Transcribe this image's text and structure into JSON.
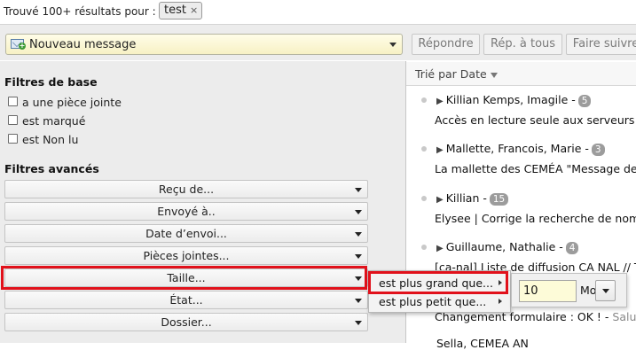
{
  "search": {
    "found_label": "Trouvé 100+ résultats pour :",
    "token": "test",
    "token_remove": "×"
  },
  "toolbar": {
    "compose_label": "Nouveau message",
    "reply": "Répondre",
    "reply_all": "Rép. à tous",
    "forward": "Faire suivre"
  },
  "filters": {
    "basic_title": "Filtres de base",
    "basic": [
      {
        "label": "a une pièce jointe",
        "checked": false
      },
      {
        "label": "est marqué",
        "checked": false
      },
      {
        "label": "est Non lu",
        "checked": false
      }
    ],
    "advanced_title": "Filtres avancés",
    "advanced": [
      "Reçu de...",
      "Envoyé à..",
      "Date d’envoi...",
      "Pièces jointes...",
      "Taille...",
      "État...",
      "Dossier..."
    ]
  },
  "list": {
    "sort_label": "Trié par Date",
    "threads": [
      {
        "head": "Killian Kemps, Imagile -",
        "count": "5",
        "subject": "Accès en lecture seule aux serveurs D",
        "snippet": ""
      },
      {
        "head": "Mallette, Francois, Marie -",
        "count": "3",
        "subject": "La mallette des CEMÉA \"Message de M",
        "snippet": ""
      },
      {
        "head": "Killian -",
        "count": "15",
        "subject": "Elysee | Corrige la recherche de noms",
        "snippet": ""
      },
      {
        "head": "Guillaume, Nathalie -",
        "count": "4",
        "subject": "[ca-nal] Liste de diffusion CA NAL // Te",
        "snippet": ""
      },
      {
        "head": "",
        "count": "",
        "subject": "Changement formulaire : OK ! - ",
        "snippet": "Salut"
      },
      {
        "head": "Sella, CEMEA AN",
        "count": "",
        "subject": "",
        "snippet": ""
      }
    ]
  },
  "size_menu": {
    "items": [
      "est plus grand que...",
      "est plus petit que..."
    ],
    "value": "10",
    "unit": "Mo"
  },
  "colors": {
    "highlight": "#e1111b",
    "compose_bg": "#f7f1c4",
    "pane_bg": "#ececec"
  }
}
